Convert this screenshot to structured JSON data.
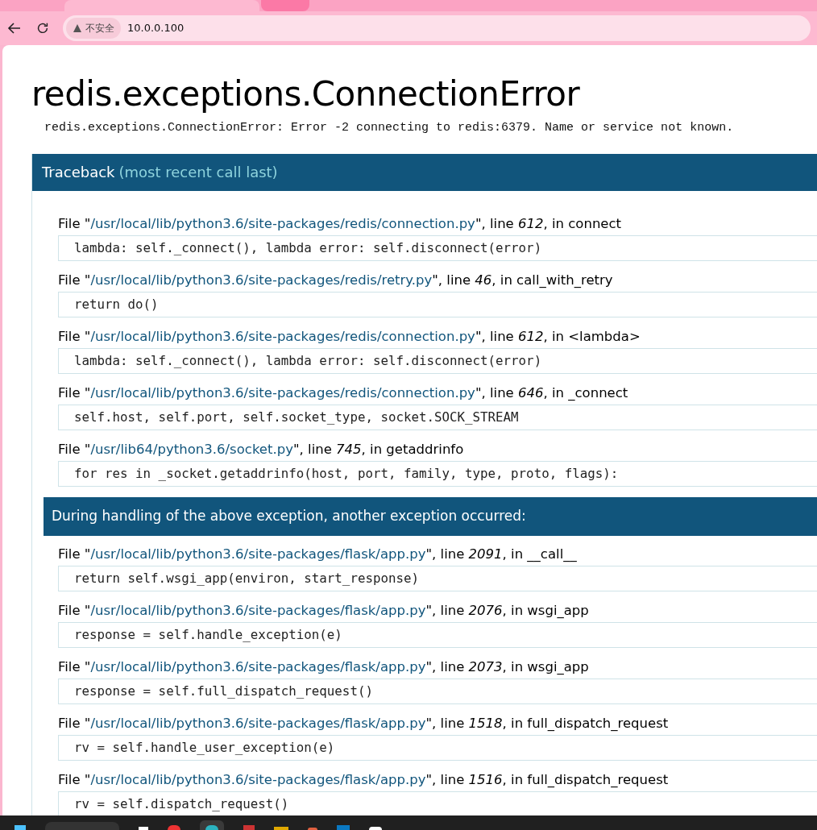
{
  "browser": {
    "security_label": "不安全",
    "address": "10.0.0.100"
  },
  "error": {
    "title": "redis.exceptions.ConnectionError",
    "message": "redis.exceptions.ConnectionError: Error -2 connecting to redis:6379. Name or service not known."
  },
  "traceback": {
    "title": "Traceback",
    "subtitle": "(most recent call last)",
    "frames": [
      {
        "prefix": "File \"",
        "path": "/usr/local/lib/python3.6/site-packages/redis/connection.py",
        "line_label": "\", line ",
        "line": "612",
        "in_label": ", in ",
        "function": "connect",
        "code": "lambda: self._connect(), lambda error: self.disconnect(error)"
      },
      {
        "prefix": "File \"",
        "path": "/usr/local/lib/python3.6/site-packages/redis/retry.py",
        "line_label": "\", line ",
        "line": "46",
        "in_label": ", in ",
        "function": "call_with_retry",
        "code": "return do()"
      },
      {
        "prefix": "File \"",
        "path": "/usr/local/lib/python3.6/site-packages/redis/connection.py",
        "line_label": "\", line ",
        "line": "612",
        "in_label": ", in ",
        "function": "<lambda>",
        "code": "lambda: self._connect(), lambda error: self.disconnect(error)"
      },
      {
        "prefix": "File \"",
        "path": "/usr/local/lib/python3.6/site-packages/redis/connection.py",
        "line_label": "\", line ",
        "line": "646",
        "in_label": ", in ",
        "function": "_connect",
        "code": "self.host, self.port, self.socket_type, socket.SOCK_STREAM"
      },
      {
        "prefix": "File \"",
        "path": "/usr/lib64/python3.6/socket.py",
        "line_label": "\", line ",
        "line": "745",
        "in_label": ", in ",
        "function": "getaddrinfo",
        "code": "for res in _socket.getaddrinfo(host, port, family, type, proto, flags):"
      }
    ],
    "chained": {
      "title": "During handling of the above exception, another exception occurred:",
      "frames": [
        {
          "prefix": "File \"",
          "path": "/usr/local/lib/python3.6/site-packages/flask/app.py",
          "line_label": "\", line ",
          "line": "2091",
          "in_label": ", in ",
          "function": "__call__",
          "code": "return self.wsgi_app(environ, start_response)"
        },
        {
          "prefix": "File \"",
          "path": "/usr/local/lib/python3.6/site-packages/flask/app.py",
          "line_label": "\", line ",
          "line": "2076",
          "in_label": ", in ",
          "function": "wsgi_app",
          "code": "response = self.handle_exception(e)"
        },
        {
          "prefix": "File \"",
          "path": "/usr/local/lib/python3.6/site-packages/flask/app.py",
          "line_label": "\", line ",
          "line": "2073",
          "in_label": ", in ",
          "function": "wsgi_app",
          "code": "response = self.full_dispatch_request()"
        },
        {
          "prefix": "File \"",
          "path": "/usr/local/lib/python3.6/site-packages/flask/app.py",
          "line_label": "\", line ",
          "line": "1518",
          "in_label": ", in ",
          "function": "full_dispatch_request",
          "code": "rv = self.handle_user_exception(e)"
        },
        {
          "prefix": "File \"",
          "path": "/usr/local/lib/python3.6/site-packages/flask/app.py",
          "line_label": "\", line ",
          "line": "1516",
          "in_label": ", in ",
          "function": "full_dispatch_request",
          "code": "rv = self.dispatch_request()"
        }
      ]
    }
  }
}
